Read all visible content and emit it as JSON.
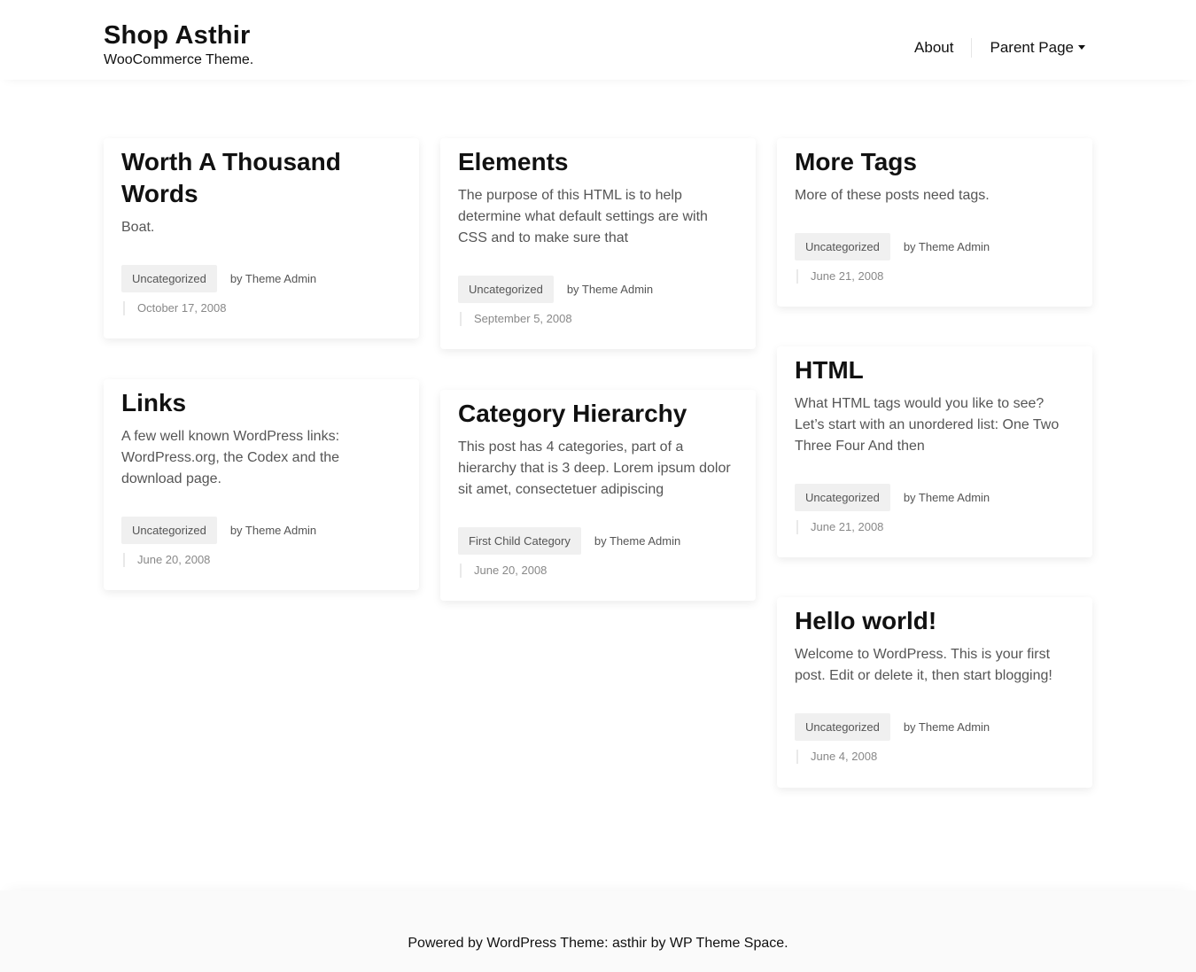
{
  "site": {
    "title": "Shop Asthir",
    "tagline": "WooCommerce Theme."
  },
  "nav": {
    "items": [
      {
        "label": "About"
      },
      {
        "label": "Parent Page",
        "icon": "caret-down-icon"
      }
    ]
  },
  "posts": [
    {
      "title": "Worth A Thousand Words",
      "excerpt": "Boat.",
      "category": "Uncategorized",
      "author": "by Theme Admin",
      "date": "October 17, 2008"
    },
    {
      "title": "Elements",
      "excerpt": "The purpose of this HTML is to help determine what default settings are with CSS and to make sure that",
      "category": "Uncategorized",
      "author": "by Theme Admin",
      "date": "September 5, 2008"
    },
    {
      "title": "More Tags",
      "excerpt": "More of these posts need tags.",
      "category": "Uncategorized",
      "author": "by Theme Admin",
      "date": "June 21, 2008"
    },
    {
      "title": "Links",
      "excerpt": "A few well known WordPress links: WordPress.org, the Codex and the download page.",
      "category": "Uncategorized",
      "author": "by Theme Admin",
      "date": "June 20, 2008"
    },
    {
      "title": "Category Hierarchy",
      "excerpt": "This post has 4 categories, part of a hierarchy that is 3 deep. Lorem ipsum dolor sit amet, consectetuer adipiscing",
      "category": "First Child Category",
      "author": "by Theme Admin",
      "date": "June 20, 2008"
    },
    {
      "title": "HTML",
      "excerpt": "What HTML tags would you like to see? Let’s start with an unordered list: One Two Three Four And then",
      "category": "Uncategorized",
      "author": "by Theme Admin",
      "date": "June 21, 2008"
    },
    {
      "title": "Hello world!",
      "excerpt": "Welcome to WordPress. This is your first post. Edit or delete it, then start blogging!",
      "category": "Uncategorized",
      "author": "by Theme Admin",
      "date": "June 4, 2008"
    }
  ],
  "footer": {
    "text": "Powered by WordPress Theme: asthir by WP Theme Space."
  },
  "colors": {
    "text": "#111111",
    "excerpt": "#555555",
    "badge_bg": "#f0f0f0",
    "date": "#888888",
    "footer_bg": "#fafafa"
  }
}
